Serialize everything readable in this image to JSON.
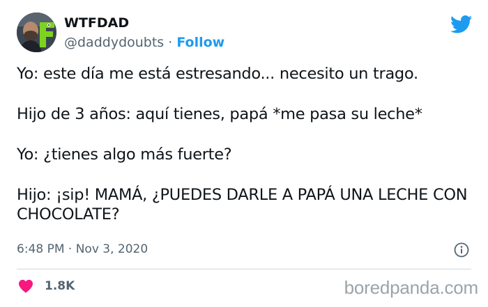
{
  "author": {
    "name": "WTFDAD",
    "handle": "@daddydoubts",
    "separator": " · ",
    "follow_label": "Follow",
    "avatar_icon": "avatar-photo"
  },
  "tweet": {
    "lines": [
      "Yo: este día me está estresando... necesito un trago.",
      "Hijo de 3 años: aquí tienes, papá *me pasa su leche*",
      "Yo: ¿tienes algo más fuerte?",
      "Hijo: ¡sip! MAMÁ, ¿PUEDES DARLE A PAPÁ UNA LECHE CON CHOCOLATE?"
    ],
    "time": "6:48 PM · Nov 3, 2020",
    "likes": "1.8K"
  },
  "icons": {
    "brand": "twitter-bird-icon",
    "info": "info-icon",
    "like": "heart-icon"
  },
  "watermark": "boredpanda.com",
  "colors": {
    "accent": "#1d9bf0",
    "heart": "#f91880",
    "muted": "#536471"
  }
}
